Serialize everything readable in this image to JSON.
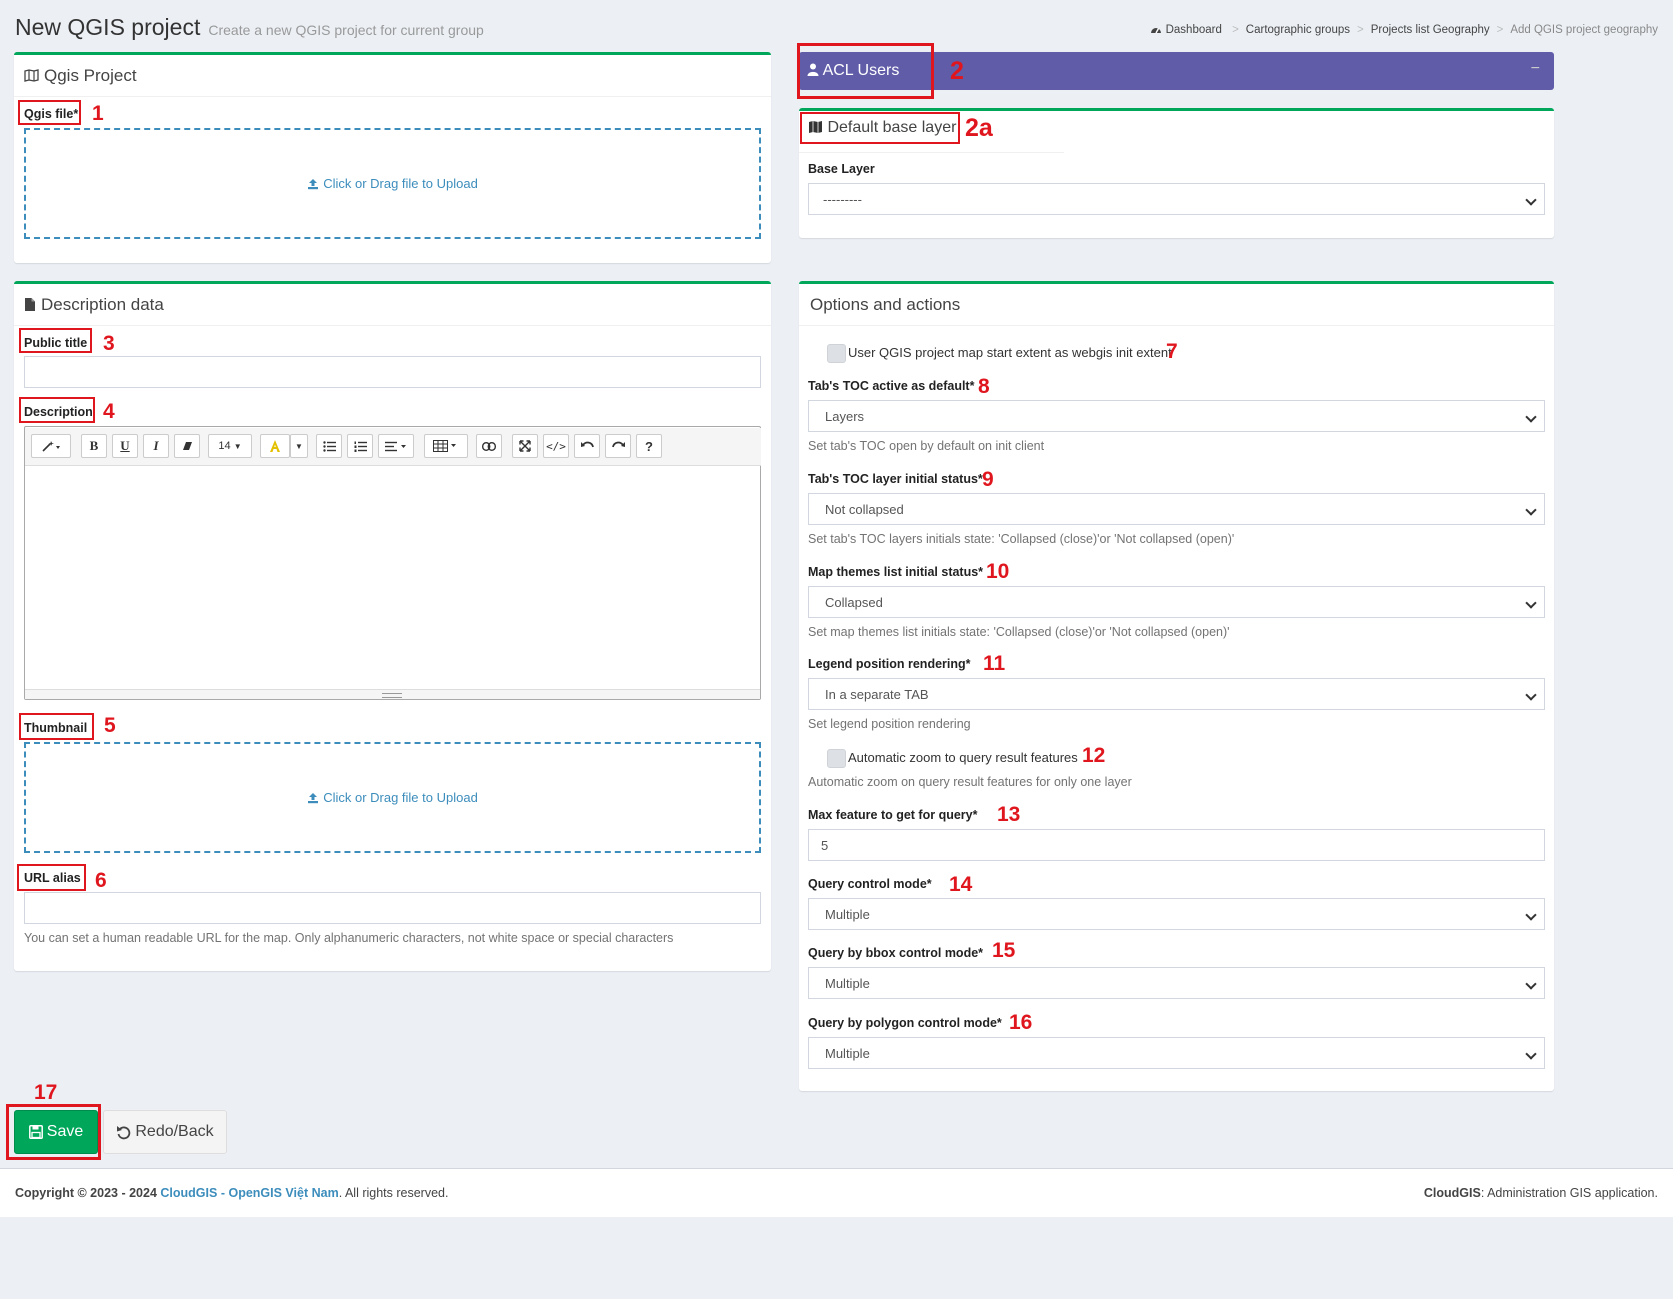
{
  "page": {
    "title": "New QGIS project",
    "subtitle": "Create a new QGIS project for current group"
  },
  "breadcrumb": [
    "Dashboard",
    "Cartographic groups",
    "Projects list Geography",
    "Add QGIS project geography"
  ],
  "qgis_project": {
    "title": "Qgis Project",
    "file_label": "Qgis file*",
    "upload_text": "Click or Drag file to Upload"
  },
  "acl": {
    "title": "ACL Users",
    "collapse": "−"
  },
  "base_layer": {
    "title": "Default base layer",
    "label": "Base Layer",
    "value": "---------"
  },
  "description_data": {
    "title": "Description data",
    "public_title_label": "Public title",
    "description_label": "Description",
    "font_size": "14",
    "thumbnail_label": "Thumbnail",
    "thumbnail_upload_text": "Click or Drag file to Upload",
    "url_alias_label": "URL alias",
    "url_alias_help": "You can set a human readable URL for the map. Only alphanumeric characters, not white space or special characters"
  },
  "options": {
    "title": "Options and actions",
    "init_extent_label": "User QGIS project map start extent as webgis init extent",
    "toc_label": "Tab's TOC active as default*",
    "toc_value": "Layers",
    "toc_help": "Set tab's TOC open by default on init client",
    "toc_layer_label": "Tab's TOC layer initial status*",
    "toc_layer_value": "Not collapsed",
    "toc_layer_help": "Set tab's TOC layers initials state: 'Collapsed (close)'or 'Not collapsed (open)'",
    "themes_label": "Map themes list initial status*",
    "themes_value": "Collapsed",
    "themes_help": "Set map themes list initials state: 'Collapsed (close)'or 'Not collapsed (open)'",
    "legend_label": "Legend position rendering*",
    "legend_value": "In a separate TAB",
    "legend_help": "Set legend position rendering",
    "autozoom_label": "Automatic zoom to query result features",
    "autozoom_help": "Automatic zoom on query result features for only one layer",
    "maxfeat_label": "Max feature to get for query*",
    "maxfeat_value": "5",
    "query_label": "Query control mode*",
    "query_value": "Multiple",
    "bbox_label": "Query by bbox control mode*",
    "bbox_value": "Multiple",
    "polygon_label": "Query by polygon control mode*",
    "polygon_value": "Multiple"
  },
  "actions": {
    "save": "Save",
    "back": "Redo/Back"
  },
  "annotations": {
    "n1": "1",
    "n2": "2",
    "n2a": "2a",
    "n3": "3",
    "n4": "4",
    "n5": "5",
    "n6": "6",
    "n7": "7",
    "n8": "8",
    "n9": "9",
    "n10": "10",
    "n11": "11",
    "n12": "12",
    "n13": "13",
    "n14": "14",
    "n15": "15",
    "n16": "16",
    "n17": "17"
  },
  "footer": {
    "copyright": "Copyright © 2023 - 2024",
    "brand1": "CloudGIS",
    "dash": "-",
    "brand2": "OpenGIS Việt Nam",
    "rights": ". All rights reserved.",
    "right_brand": "CloudGIS",
    "right_text": ": Administration GIS application."
  },
  "colors": {
    "accent_green": "#00a65a",
    "acl_header": "#605ca8",
    "annotation_red": "#e0161e",
    "link_blue": "#3c8dbc"
  }
}
